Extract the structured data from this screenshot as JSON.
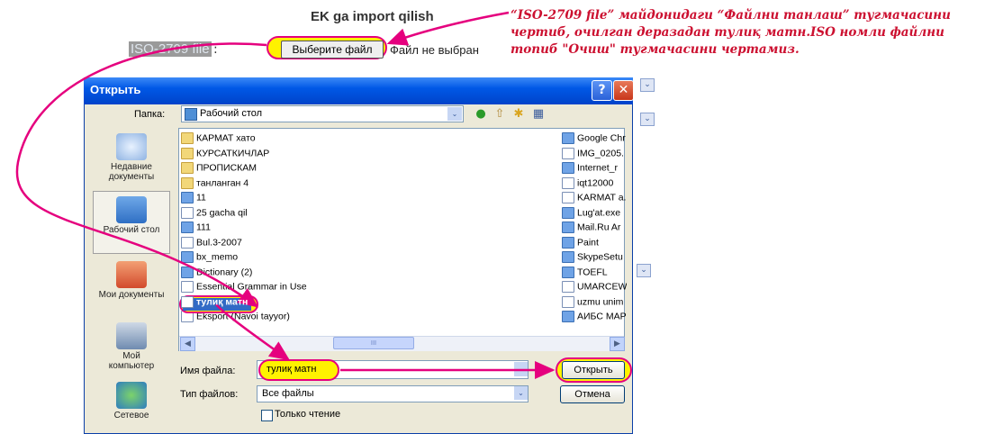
{
  "page": {
    "title": "EK ga import qilish",
    "iso_label": "ISO-2709 file",
    "iso_colon": ":",
    "choose_file_button": "Выберите файл",
    "no_file_text": "Файл не выбран",
    "annotation": "“ISO-2709 file” майдонидаги “Файлни танлаш” тугмачасини чертиб, очилган деразадан тулиқ матн.ISO номли файлни топиб \"Очиш\" тугмачасини чертамиз.",
    "side_select_arrow": "⌄"
  },
  "dialog": {
    "title": "Открыть",
    "help_glyph": "?",
    "close_glyph": "✕",
    "folder_label": "Папка:",
    "folder_value": "Рабочий стол",
    "places": [
      {
        "label": "Недавние документы"
      },
      {
        "label": "Рабочий стол"
      },
      {
        "label": "Мои документы"
      },
      {
        "label": "Мой компьютер"
      },
      {
        "label": "Сетевое"
      }
    ],
    "files_col1": [
      {
        "name": "КАРМАТ хато",
        "kind": "folder"
      },
      {
        "name": "КУРСАТКИЧЛАР",
        "kind": "folder"
      },
      {
        "name": "ПРОПИСКАМ",
        "kind": "folder"
      },
      {
        "name": "танланган 4",
        "kind": "folder"
      },
      {
        "name": "11",
        "kind": "app"
      },
      {
        "name": "25 gacha qil",
        "kind": "doc"
      },
      {
        "name": "111",
        "kind": "app"
      },
      {
        "name": "Bul.3-2007",
        "kind": "doc"
      },
      {
        "name": "bx_memo",
        "kind": "app"
      },
      {
        "name": "Dictionary (2)",
        "kind": "app"
      },
      {
        "name": "Essential Grammar in Use",
        "kind": "doc"
      },
      {
        "name": "тулиқ матн",
        "kind": "doc"
      },
      {
        "name": "Eksport (Navoi tayyor)",
        "kind": "doc"
      }
    ],
    "files_col2": [
      {
        "name": "Google Chr",
        "kind": "app"
      },
      {
        "name": "IMG_0205.",
        "kind": "doc"
      },
      {
        "name": "Internet_r",
        "kind": "app"
      },
      {
        "name": "iqt12000",
        "kind": "doc"
      },
      {
        "name": "KARMAT a.",
        "kind": "doc"
      },
      {
        "name": "Lug'at.exe",
        "kind": "app"
      },
      {
        "name": "Mail.Ru Ar",
        "kind": "app"
      },
      {
        "name": "Paint",
        "kind": "app"
      },
      {
        "name": "SkypeSetu",
        "kind": "app"
      },
      {
        "name": "TOEFL",
        "kind": "app"
      },
      {
        "name": "UMARCEW",
        "kind": "doc"
      },
      {
        "name": "uzmu unim",
        "kind": "doc"
      },
      {
        "name": "АИБС МАР",
        "kind": "app"
      }
    ],
    "scroll_left": "◀",
    "scroll_right": "▶",
    "scroll_grip": "III",
    "filename_label": "Имя файла:",
    "filename_value": "тулиқ матн",
    "filetype_label": "Тип файлов:",
    "filetype_value": "Все файлы",
    "combo_arrow": "⌄",
    "open_button": "Открыть",
    "cancel_button": "Отмена",
    "readonly_label": "Только чтение"
  },
  "colors": {
    "highlight": "#fff200",
    "annotation_arrow": "#e5007e",
    "annotation_text": "#cc1030",
    "xp_title": "#0058e6"
  }
}
